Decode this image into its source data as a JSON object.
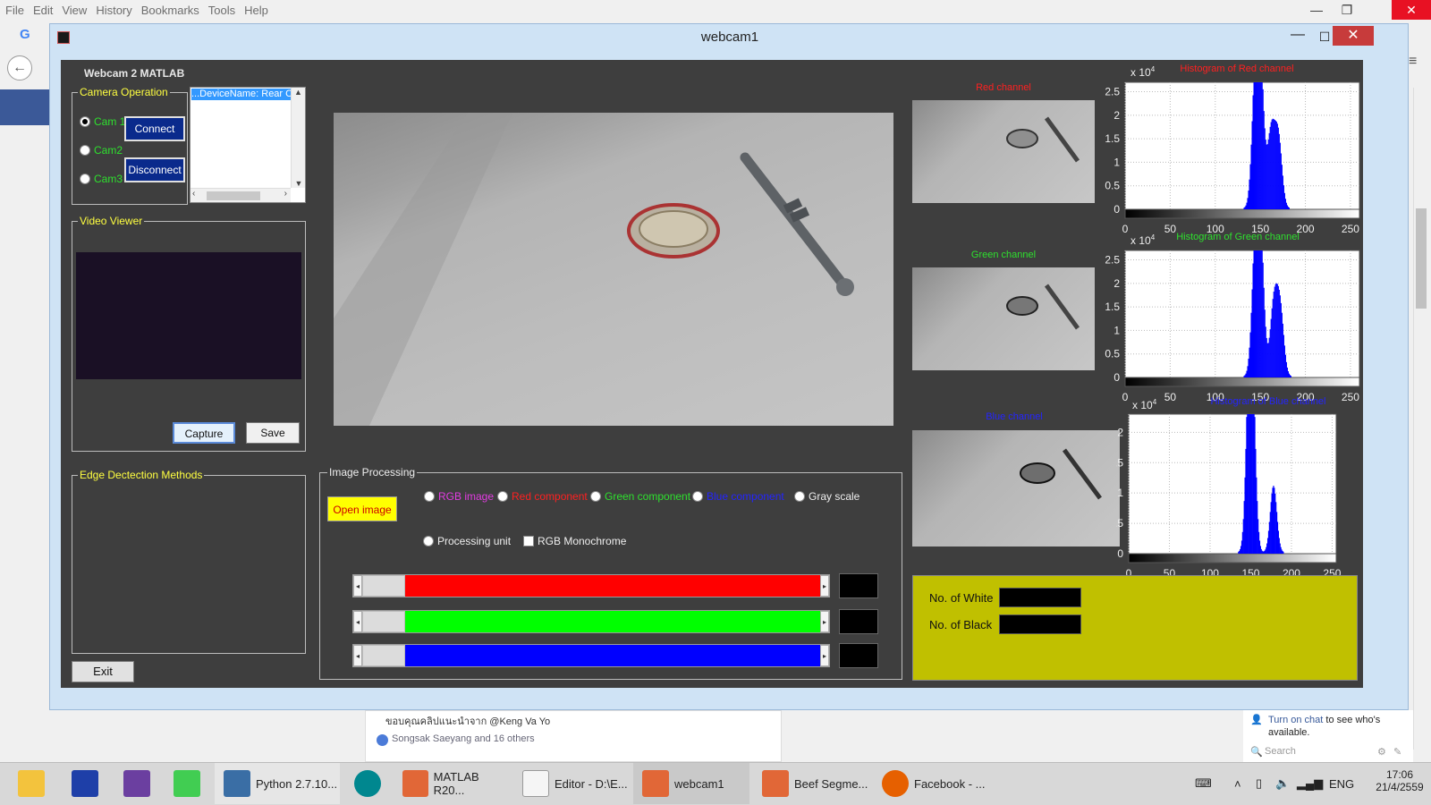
{
  "browser": {
    "menu": [
      "File",
      "Edit",
      "View",
      "History",
      "Bookmarks",
      "Tools",
      "Help"
    ],
    "feed_post_text": "ขอบคุณคลิปแนะนำจาก @Keng Va Yo",
    "feed_likes": "Songsak Saeyang and 16 others",
    "chat_link": "Turn on chat",
    "chat_text": "to see who's available.",
    "chat_search_placeholder": "Search"
  },
  "window": {
    "title": "webcam1"
  },
  "gui": {
    "title": "Webcam 2 MATLAB",
    "camera_panel": "Camera Operation",
    "cameras": [
      {
        "label": "Cam 1",
        "selected": true
      },
      {
        "label": "Cam2",
        "selected": false
      },
      {
        "label": "Cam3",
        "selected": false
      }
    ],
    "connect_label": "Connect",
    "disconnect_label": "Disconnect",
    "device_list_item": "...DeviceName: Rear C...",
    "video_viewer_panel": "Video Viewer",
    "capture_label": "Capture",
    "save_label": "Save",
    "edge_panel": "Edge Dectection Methods",
    "exit_label": "Exit",
    "image_processing_panel": "Image Processing",
    "open_image_label": "Open image",
    "options": [
      {
        "label": "RGB image",
        "color": "#e23ce2"
      },
      {
        "label": "Red component",
        "color": "#ff2020"
      },
      {
        "label": "Green component",
        "color": "#2ee02e"
      },
      {
        "label": "Blue component",
        "color": "#2424ff"
      },
      {
        "label": "Gray scale",
        "color": "#eeeeee"
      }
    ],
    "processing_unit_label": "Processing unit",
    "rgb_mono_label": "RGB Monochrome",
    "sliders": [
      {
        "name": "red",
        "color": "#ff0000",
        "value": 0
      },
      {
        "name": "green",
        "color": "#00ff00",
        "value": 0
      },
      {
        "name": "blue",
        "color": "#0000ff",
        "value": 0
      }
    ],
    "channels": {
      "red_title": "Red channel",
      "green_title": "Green channel",
      "blue_title": "Blue channel",
      "hist_red_title": "Histogram of Red channel",
      "hist_green_title": "Histogram of Green channel",
      "hist_blue_title": "Histogram of Blue channel",
      "exp_label": "x 10",
      "exp_power": "4"
    },
    "counts": {
      "white_label": "No. of White",
      "black_label": "No. of Black"
    }
  },
  "chart_data": [
    {
      "type": "bar",
      "title": "Histogram of Red channel",
      "x_ticks": [
        "0",
        "50",
        "100",
        "150",
        "200",
        "250"
      ],
      "y_ticks": [
        "0",
        "0.5",
        "1",
        "1.5",
        "2",
        "2.5"
      ],
      "ylim": [
        0,
        2.7
      ],
      "xlim": [
        0,
        260
      ],
      "peaks": [
        {
          "x": 145,
          "y": 2.7
        },
        {
          "x": 150,
          "y": 2.7
        },
        {
          "x": 162,
          "y": 1.6
        },
        {
          "x": 170,
          "y": 1.5
        }
      ],
      "exponent": "x 10^4"
    },
    {
      "type": "bar",
      "title": "Histogram of Green channel",
      "x_ticks": [
        "0",
        "50",
        "100",
        "150",
        "200",
        "250"
      ],
      "y_ticks": [
        "0",
        "0.5",
        "1",
        "1.5",
        "2",
        "2.5"
      ],
      "ylim": [
        0,
        2.7
      ],
      "xlim": [
        0,
        260
      ],
      "peaks": [
        {
          "x": 145,
          "y": 2.7
        },
        {
          "x": 150,
          "y": 2.7
        },
        {
          "x": 165,
          "y": 1.5
        },
        {
          "x": 172,
          "y": 1.4
        }
      ],
      "exponent": "x 10^4"
    },
    {
      "type": "bar",
      "title": "Histogram of Blue channel",
      "x_ticks": [
        "0",
        "50",
        "100",
        "150",
        "200",
        "250"
      ],
      "y_ticks": [
        "0",
        "0.5",
        "1",
        "1.5",
        "2"
      ],
      "ylim": [
        0,
        2.3
      ],
      "xlim": [
        0,
        255
      ],
      "peaks": [
        {
          "x": 148,
          "y": 2.3
        },
        {
          "x": 152,
          "y": 2.3
        },
        {
          "x": 178,
          "y": 1.1
        }
      ],
      "exponent": "x 10^4"
    }
  ],
  "taskbar": {
    "items": [
      "Python 2.7.10...",
      "MATLAB R20...",
      "Editor - D:\\E...",
      "webcam1",
      "Beef Segme...",
      "Facebook - ..."
    ],
    "lang": "ENG",
    "time": "17:06",
    "date": "21/4/2559"
  }
}
